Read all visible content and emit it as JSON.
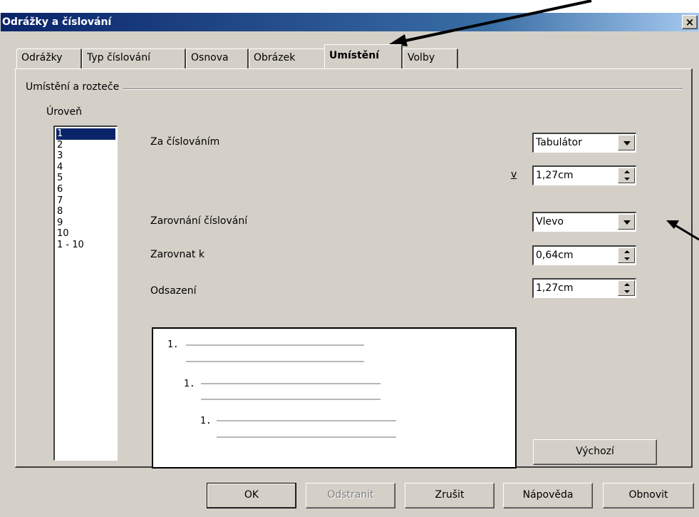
{
  "dialog": {
    "title": "Odrážky a číslování",
    "close_label": "×"
  },
  "tabs": [
    {
      "label": "Odrážky"
    },
    {
      "label": "Typ číslování"
    },
    {
      "label": "Osnova"
    },
    {
      "label": "Obrázek"
    },
    {
      "label": "Umístění",
      "active": true
    },
    {
      "label": "Volby"
    }
  ],
  "group": {
    "title": "Umístění a rozteče",
    "level_label": "Úroveň",
    "levels": [
      "1",
      "2",
      "3",
      "4",
      "5",
      "6",
      "7",
      "8",
      "9",
      "10",
      "1 - 10"
    ],
    "selected_level": "1"
  },
  "fields": {
    "after_numbering_label": "Za číslováním",
    "after_numbering_value": "Tabulátor",
    "at_label": "v",
    "at_value": "1,27cm",
    "numbering_alignment_label": "Zarovnání číslování",
    "numbering_alignment_value": "Vlevo",
    "align_at_label": "Zarovnat k",
    "align_at_value": "0,64cm",
    "indent_label": "Odsazení",
    "indent_value": "1,27cm"
  },
  "preview": {
    "items": [
      "1.",
      "1.",
      "1."
    ]
  },
  "buttons": {
    "default": "Výchozí",
    "ok": "OK",
    "remove": "Odstranit",
    "cancel": "Zrušit",
    "help": "Nápověda",
    "reset": "Obnovit"
  },
  "colors": {
    "dialog_bg": "#d4d0c8",
    "titlebar": "#0a246a",
    "selection": "#0a246a"
  }
}
